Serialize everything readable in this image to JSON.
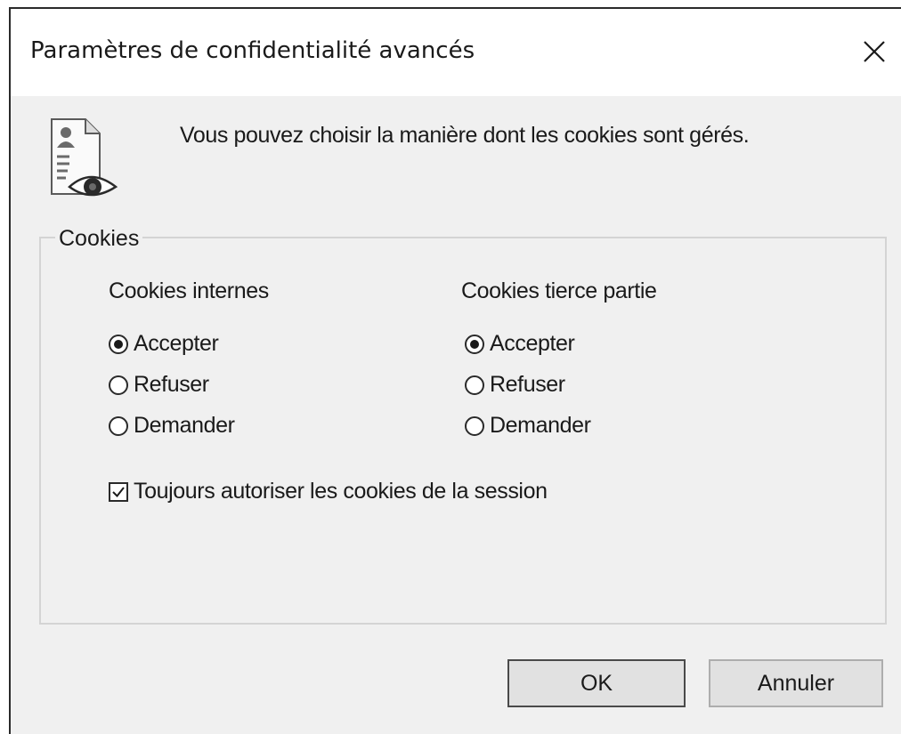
{
  "window": {
    "title": "Paramètres de confidentialité avancés",
    "close_icon": "close-icon"
  },
  "header": {
    "icon": "privacy-document-eye-icon",
    "intro_text": "Vous pouvez choisir la manière dont les cookies sont gérés."
  },
  "cookies_group": {
    "legend": "Cookies",
    "first_party": {
      "heading": "Cookies internes",
      "options": [
        {
          "label": "Accepter",
          "selected": true
        },
        {
          "label": "Refuser",
          "selected": false
        },
        {
          "label": "Demander",
          "selected": false
        }
      ]
    },
    "third_party": {
      "heading": "Cookies tierce partie",
      "options": [
        {
          "label": "Accepter",
          "selected": true
        },
        {
          "label": "Refuser",
          "selected": false
        },
        {
          "label": "Demander",
          "selected": false
        }
      ]
    },
    "session_checkbox": {
      "label": "Toujours autoriser les cookies de la session",
      "checked": true
    }
  },
  "buttons": {
    "ok_label": "OK",
    "cancel_label": "Annuler"
  },
  "colors": {
    "dialog_background": "#f0f0f0",
    "title_background": "#ffffff",
    "button_face": "#e1e1e1"
  }
}
